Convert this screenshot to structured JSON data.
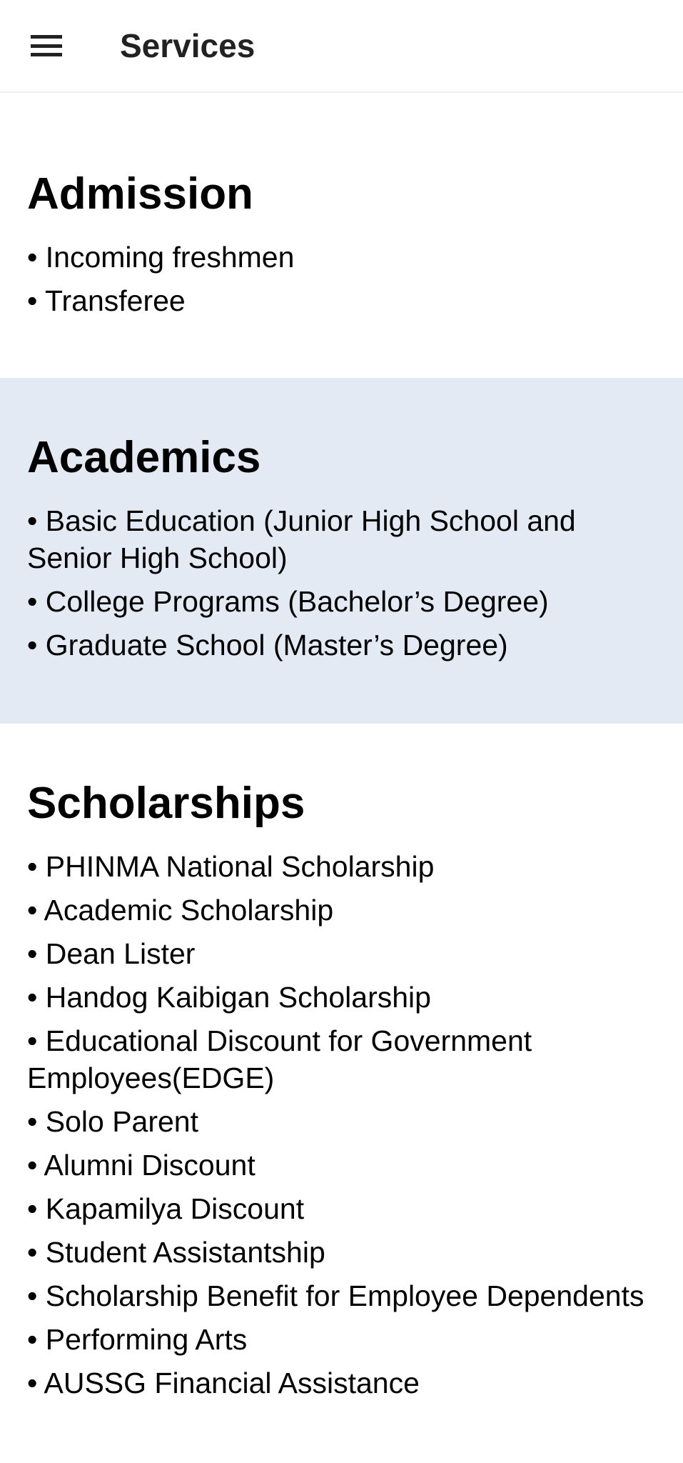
{
  "header": {
    "title": "Services",
    "menu_icon": "hamburger-menu-icon"
  },
  "colors": {
    "academics_background": "#e3eaf3"
  },
  "sections": [
    {
      "title": "Admission",
      "items": [
        "• Incoming freshmen",
        "• Transferee"
      ]
    },
    {
      "title": "Academics",
      "items": [
        "• Basic Education (Junior High School and Senior High School)",
        "• College Programs (Bachelor’s Degree)",
        "• Graduate School (Master’s Degree)"
      ]
    },
    {
      "title": "Scholarships",
      "items": [
        "• PHINMA National Scholarship",
        "• Academic Scholarship",
        "• Dean Lister",
        "• Handog Kaibigan Scholarship",
        "• Educational Discount for Government Employees(EDGE)",
        "• Solo Parent",
        "• Alumni Discount",
        "• Kapamilya Discount",
        "• Student Assistantship",
        "• Scholarship Benefit for Employee Dependents",
        "• Performing Arts",
        "• AUSSG Financial Assistance"
      ]
    }
  ]
}
